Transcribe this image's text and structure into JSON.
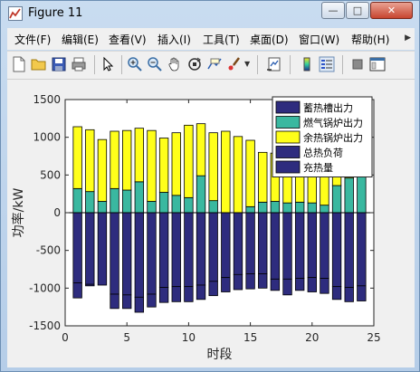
{
  "window": {
    "title": "Figure 11"
  },
  "window_controls": {
    "minimize": "—",
    "maximize": "□",
    "close": "✕"
  },
  "menu": [
    {
      "label": "文件(F)"
    },
    {
      "label": "编辑(E)"
    },
    {
      "label": "查看(V)"
    },
    {
      "label": "插入(I)"
    },
    {
      "label": "工具(T)"
    },
    {
      "label": "桌面(D)"
    },
    {
      "label": "窗口(W)"
    },
    {
      "label": "帮助(H)"
    }
  ],
  "toolbar": [
    "new-figure-icon",
    "open-file-icon",
    "save-icon",
    "print-icon",
    "edit-plot-arrow-icon",
    "zoom-in-icon",
    "zoom-out-icon",
    "pan-hand-icon",
    "rotate-3d-icon",
    "data-cursor-icon",
    "brush-icon",
    "link-plot-icon",
    "colorbar-icon",
    "legend-icon",
    "hide-plot-tools-icon",
    "show-plot-tools-icon"
  ],
  "colors": {
    "storage_discharge": "#2e2c7e",
    "gas_boiler": "#3ab8a0",
    "waste_heat_boiler": "#ffff1a",
    "total_load": "#2e2c7e",
    "storage_charge": "#2e2c7e"
  },
  "chart_data": {
    "type": "bar",
    "stacked": true,
    "xlabel": "时段",
    "ylabel": "功率/kW",
    "xlim": [
      0,
      25
    ],
    "ylim": [
      -1500,
      1500
    ],
    "xticks": [
      0,
      5,
      10,
      15,
      20,
      25
    ],
    "yticks": [
      -1500,
      -1000,
      -500,
      0,
      500,
      1000,
      1500
    ],
    "grid": false,
    "legend_position": "top-right",
    "x": [
      1,
      2,
      3,
      4,
      5,
      6,
      7,
      8,
      9,
      10,
      11,
      12,
      13,
      14,
      15,
      16,
      17,
      18,
      19,
      20,
      21,
      22,
      23,
      24
    ],
    "series": [
      {
        "name": "蓄热槽出力",
        "color_key": "storage_discharge",
        "values": [
          0,
          0,
          0,
          0,
          0,
          0,
          0,
          0,
          0,
          0,
          0,
          0,
          0,
          0,
          0,
          0,
          0,
          0,
          0,
          0,
          0,
          0,
          0,
          0
        ]
      },
      {
        "name": "燃气锅炉出力",
        "color_key": "gas_boiler",
        "values": [
          320,
          280,
          150,
          320,
          300,
          410,
          150,
          270,
          230,
          200,
          490,
          160,
          0,
          0,
          80,
          140,
          150,
          130,
          140,
          130,
          100,
          360,
          460,
          490
        ]
      },
      {
        "name": "余热锅炉出力",
        "color_key": "waste_heat_boiler",
        "values": [
          820,
          820,
          820,
          760,
          790,
          710,
          940,
          720,
          830,
          960,
          690,
          900,
          1080,
          1010,
          880,
          660,
          640,
          690,
          680,
          650,
          690,
          790,
          650,
          420
        ]
      },
      {
        "name": "总热负荷",
        "color_key": "total_load",
        "values": [
          -930,
          -950,
          -960,
          -1080,
          -1090,
          -1120,
          -1080,
          -990,
          -980,
          -980,
          -960,
          -910,
          -860,
          -820,
          -810,
          -810,
          -880,
          -880,
          -870,
          -860,
          -870,
          -980,
          -990,
          -970
        ]
      },
      {
        "name": "充热量",
        "color_key": "storage_charge",
        "values": [
          -200,
          -20,
          0,
          -190,
          -180,
          -200,
          -170,
          -200,
          -200,
          -200,
          -190,
          -190,
          -190,
          -200,
          -200,
          -190,
          -150,
          -210,
          -160,
          -190,
          -200,
          -170,
          -190,
          -200
        ]
      }
    ]
  }
}
